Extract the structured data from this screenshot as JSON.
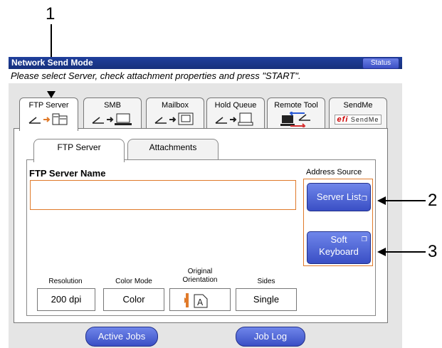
{
  "callouts": [
    "1",
    "2",
    "3"
  ],
  "window": {
    "title": "Network Send Mode",
    "status_label": "Status",
    "instruction": "Please select Server, check attachment properties and press \"START\"."
  },
  "tabs": [
    {
      "label": "FTP Server"
    },
    {
      "label": "SMB"
    },
    {
      "label": "Mailbox"
    },
    {
      "label": "Hold Queue"
    },
    {
      "label": "Remote Tool"
    },
    {
      "label": "SendMe",
      "brand": "efi",
      "brand_text": "SendMe"
    }
  ],
  "subtabs": [
    {
      "label": "FTP Server"
    },
    {
      "label": "Attachments"
    }
  ],
  "ftp": {
    "name_label": "FTP Server Name",
    "name_value": "",
    "address_source_label": "Address Source",
    "server_list_label": "Server List",
    "soft_keyboard_line1": "Soft",
    "soft_keyboard_line2": "Keyboard"
  },
  "settings": [
    {
      "label": "Resolution",
      "value": "200 dpi"
    },
    {
      "label": "Color Mode",
      "value": "Color"
    },
    {
      "label": "Original Orientation",
      "value": ""
    },
    {
      "label": "Sides",
      "value": "Single"
    }
  ],
  "bottom": {
    "active_jobs": "Active Jobs",
    "job_log": "Job Log"
  },
  "colors": {
    "titlebar": "#1f3f9c",
    "button": "#4a60d6",
    "accent_orange": "#e07a2a"
  }
}
